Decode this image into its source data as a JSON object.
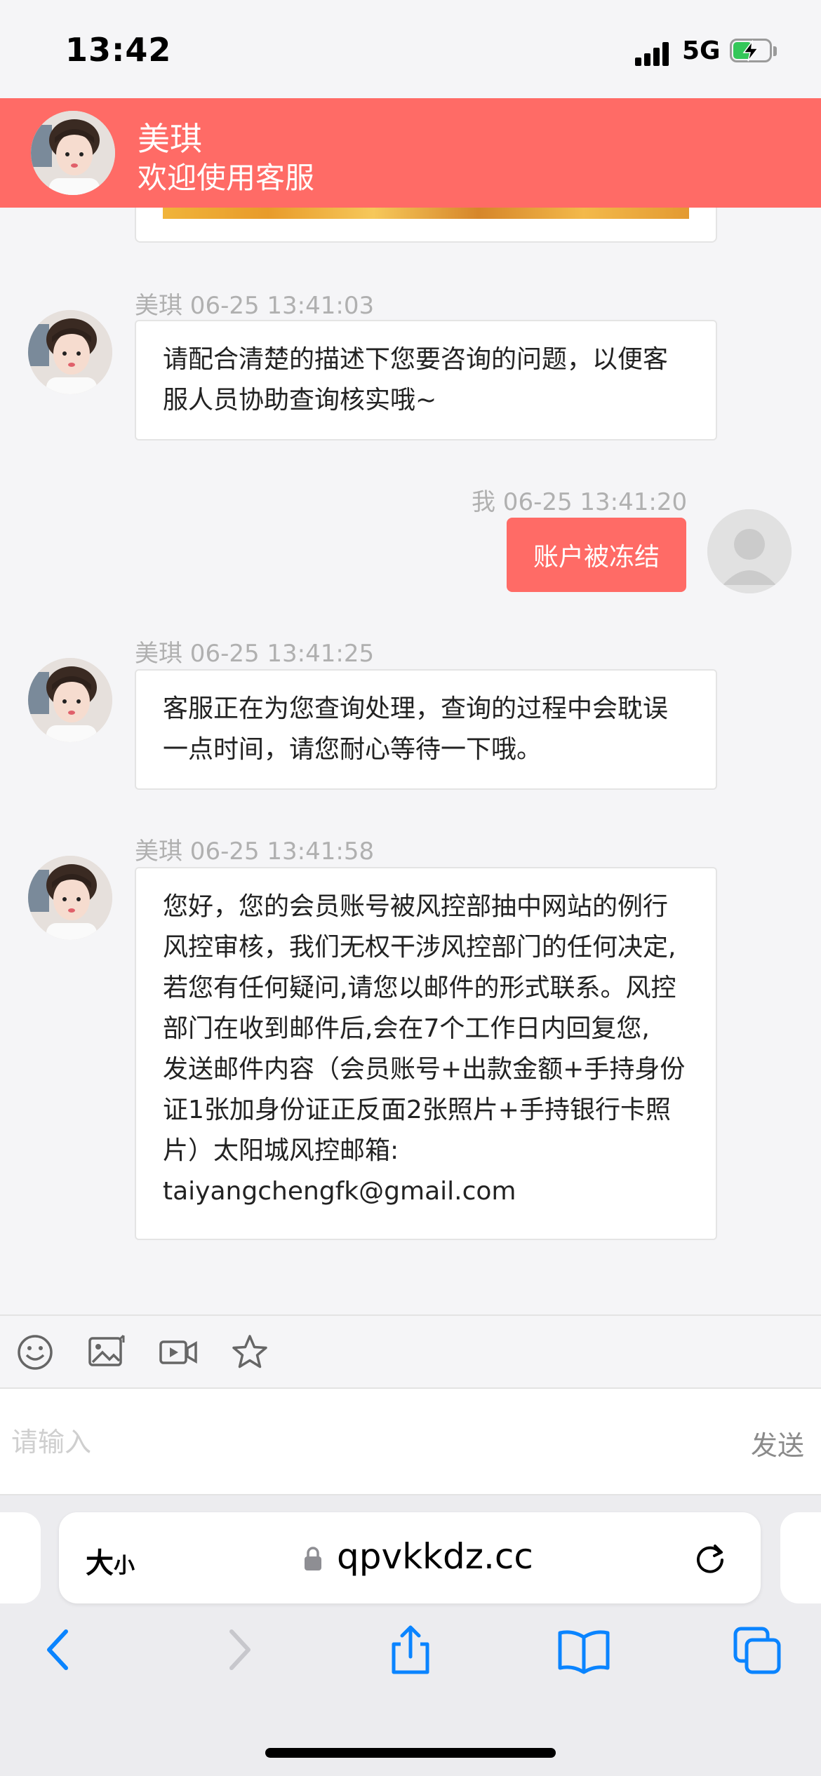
{
  "status_bar": {
    "time": "13:42",
    "network": "5G"
  },
  "header": {
    "agent_name": "美琪",
    "subtitle": "欢迎使用客服"
  },
  "messages": [
    {
      "meta": "美琪  06-25 13:41:03",
      "lines": [
        "请配合清楚的描述下您要咨询的问题，以便客",
        "服人员协助查询核实哦~"
      ]
    },
    {
      "meta": "我 06-25 13:41:20",
      "text": "账户被冻结"
    },
    {
      "meta": "美琪  06-25 13:41:25",
      "lines": [
        "客服正在为您查询处理，查询的过程中会耽误",
        "一点时间，请您耐心等待一下哦。"
      ]
    },
    {
      "meta": "美琪  06-25 13:41:58",
      "lines": [
        "您好，您的会员账号被风控部抽中网站的例行",
        "风控审核，我们无权干涉风控部门的任何决定,",
        "若您有任何疑问,请您以邮件的形式联系。风控",
        "部门在收到邮件后,会在7个工作日内回复您,",
        "发送邮件内容（会员账号+出款金额+手持身份",
        "证1张加身份证正反面2张照片+手持银行卡照",
        "片）太阳城风控邮箱:",
        "taiyangchengfk@gmail.com"
      ]
    }
  ],
  "input": {
    "placeholder": "请输入",
    "send_label": "发送"
  },
  "toolbar_icons": [
    "emoji-icon",
    "image-icon",
    "video-icon",
    "star-icon"
  ],
  "browser": {
    "text_size_big": "大",
    "text_size_small": "小",
    "url": "qpvkkdz.cc"
  },
  "colors": {
    "accent": "#ff6b66",
    "background": "#f5f5f7"
  }
}
